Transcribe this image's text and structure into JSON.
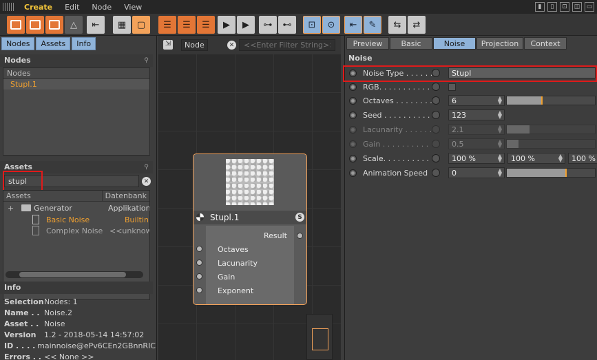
{
  "menubar": {
    "items": [
      "Create",
      "Edit",
      "Node",
      "View"
    ]
  },
  "left": {
    "tabs": [
      "Nodes",
      "Assets",
      "Info"
    ],
    "nodes_section": "Nodes",
    "nodes_header": "Nodes",
    "nodes_item": "Stupl.1",
    "assets_section": "Assets",
    "search_value": "stupl",
    "asset_cols": [
      "Assets",
      "Datenbank"
    ],
    "asset_rows": [
      {
        "name": "Generator",
        "db": "Applikation"
      },
      {
        "name": "Basic Noise",
        "db": "Builtin"
      },
      {
        "name": "Complex Noise",
        "db": "<<unknown"
      }
    ],
    "info_section": "Info",
    "info": [
      {
        "k": "Selection",
        "v": "Nodes: 1"
      },
      {
        "k": "Name . . .",
        "v": "Noise.2"
      },
      {
        "k": "Asset . . .",
        "v": "Noise"
      },
      {
        "k": "Version",
        "v": "1.2 - 2018-05-14 14:57:02"
      },
      {
        "k": "ID . . . . . .",
        "v": "mainnoise@ePv6CEn2GBnnRIC"
      },
      {
        "k": "Errors . .",
        "v": "<< None >>"
      }
    ]
  },
  "center": {
    "pill": "Node",
    "filter_placeholder": "<<Enter Filter String>>",
    "node_title": "Stupl.1",
    "node_badge": "S",
    "output": "Result",
    "inputs": [
      "Octaves",
      "Lacunarity",
      "Gain",
      "Exponent"
    ]
  },
  "right": {
    "tabs": [
      "Preview",
      "Basic",
      "Noise",
      "Projection",
      "Context"
    ],
    "section": "Noise",
    "props": {
      "noise_type": {
        "label": "Noise Type . . . . . .",
        "value": "Stupl"
      },
      "rgb": {
        "label": "RGB. . . . . . . . . . . ."
      },
      "octaves": {
        "label": "Octaves . . . . . . . .",
        "value": "6",
        "level": 0.4
      },
      "seed": {
        "label": "Seed . . . . . . . . . .",
        "value": "123"
      },
      "lacunarity": {
        "label": "Lacunarity . . . . . .",
        "value": "2.1",
        "level": 0.26
      },
      "gain": {
        "label": "Gain . . . . . . . . . .",
        "value": "0.5",
        "level": 0.13
      },
      "scale": {
        "label": "Scale. . . . . . . . . .",
        "values": [
          "100 %",
          "100 %",
          "100 %"
        ]
      },
      "anim_speed": {
        "label": "Animation Speed",
        "value": "0",
        "level": 0.67
      }
    }
  },
  "colors": {
    "accent": "#f3a25a",
    "highlight": "#e01a1a",
    "tab_selected": "#8fb3d9"
  }
}
